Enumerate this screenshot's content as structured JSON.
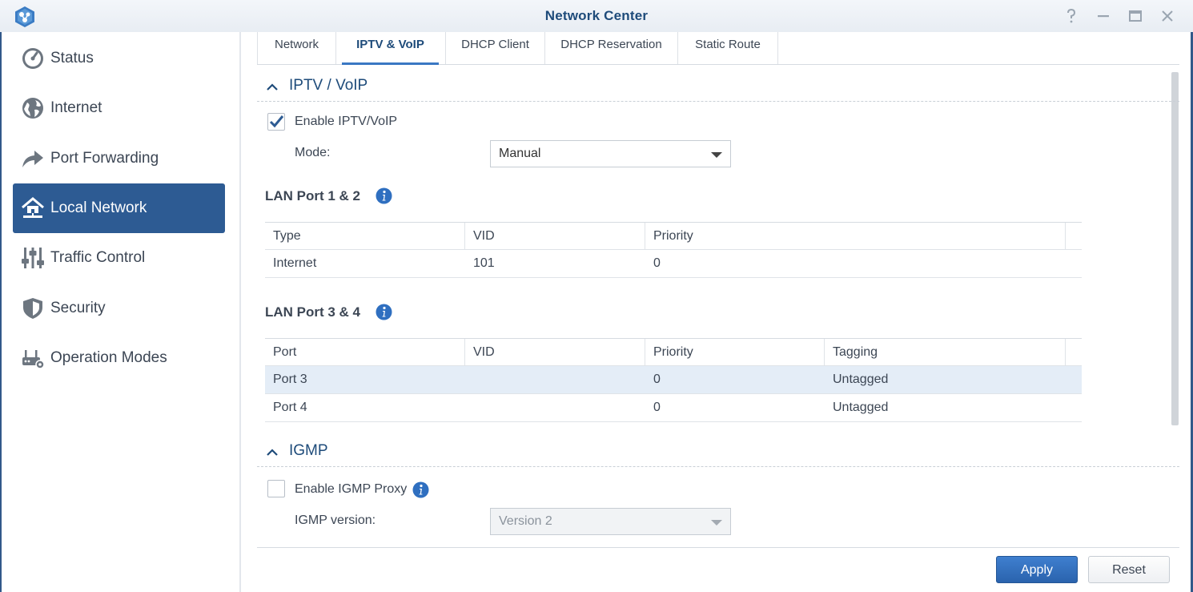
{
  "window": {
    "title": "Network Center",
    "controls": [
      "help-icon",
      "minimize-icon",
      "maximize-icon",
      "close-icon"
    ]
  },
  "sidebar": {
    "items": [
      {
        "label": "Status",
        "icon": "gauge-icon"
      },
      {
        "label": "Internet",
        "icon": "globe-icon"
      },
      {
        "label": "Port Forwarding",
        "icon": "forward-arrow-icon"
      },
      {
        "label": "Local Network",
        "icon": "home-network-icon",
        "active": true
      },
      {
        "label": "Traffic Control",
        "icon": "sliders-icon"
      },
      {
        "label": "Security",
        "icon": "shield-icon"
      },
      {
        "label": "Operation Modes",
        "icon": "router-gear-icon"
      }
    ]
  },
  "tabs": [
    {
      "label": "Network"
    },
    {
      "label": "IPTV & VoIP",
      "active": true
    },
    {
      "label": "DHCP Client"
    },
    {
      "label": "DHCP Reservation"
    },
    {
      "label": "Static Route"
    }
  ],
  "iptv": {
    "section_title": "IPTV / VoIP",
    "enable_label": "Enable IPTV/VoIP",
    "enabled": true,
    "mode_label": "Mode:",
    "mode_value": "Manual",
    "lan12": {
      "title": "LAN Port 1 & 2",
      "columns": [
        "Type",
        "VID",
        "Priority"
      ],
      "rows": [
        [
          "Internet",
          "101",
          "0"
        ]
      ]
    },
    "lan34": {
      "title": "LAN Port 3 & 4",
      "columns": [
        "Port",
        "VID",
        "Priority",
        "Tagging"
      ],
      "rows": [
        [
          "Port 3",
          "",
          "0",
          "Untagged"
        ],
        [
          "Port 4",
          "",
          "0",
          "Untagged"
        ]
      ]
    }
  },
  "igmp": {
    "section_title": "IGMP",
    "enable_label": "Enable IGMP Proxy",
    "enabled": false,
    "version_label": "IGMP version:",
    "version_value": "Version 2"
  },
  "footer": {
    "apply_label": "Apply",
    "reset_label": "Reset"
  },
  "colors": {
    "accent": "#2d5b93",
    "title": "#1e4b7a",
    "selected_row": "#e4edf7"
  }
}
